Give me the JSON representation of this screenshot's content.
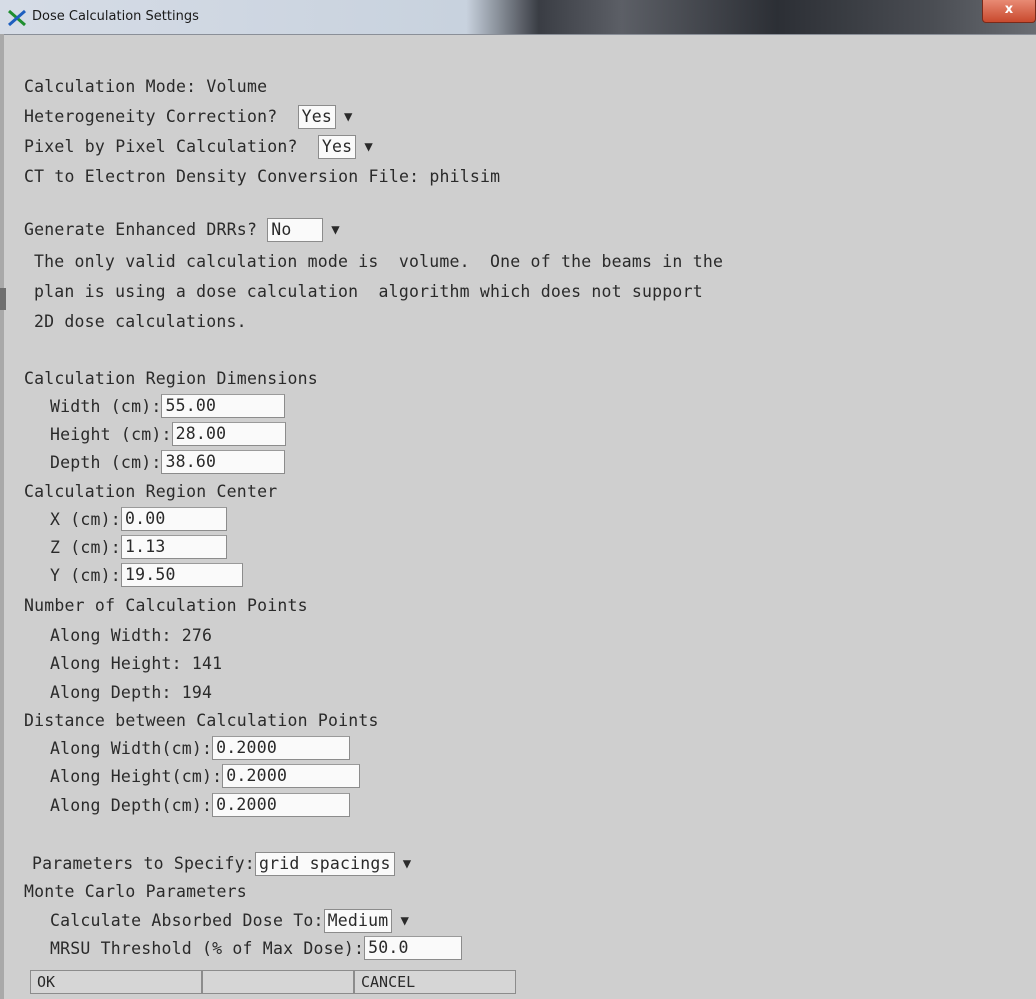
{
  "window": {
    "title": "Dose Calculation Settings",
    "close_label": "x"
  },
  "settings": {
    "calc_mode_line": "Calculation Mode: Volume",
    "hetero_label": "Heterogeneity Correction?",
    "hetero_value": "Yes",
    "pixel_label": "Pixel by Pixel Calculation?",
    "pixel_value": "Yes",
    "ct_line": "CT to Electron Density Conversion File: philsim",
    "drr_label": "Generate Enhanced DRRs?",
    "drr_value": "No",
    "message_lines": [
      "The only valid calculation mode is  volume.  One of the beams in the",
      "plan is using a dose calculation  algorithm which does not support",
      "2D dose calculations."
    ]
  },
  "region_dimensions": {
    "heading": "Calculation Region Dimensions",
    "width_label": "Width (cm):",
    "width_value": "55.00",
    "height_label": "Height (cm):",
    "height_value": "28.00",
    "depth_label": "Depth (cm):",
    "depth_value": "38.60"
  },
  "region_center": {
    "heading": "Calculation Region Center",
    "x_label": "X (cm):",
    "x_value": "0.00",
    "z_label": "Z (cm):",
    "z_value": "1.13",
    "y_label": "Y (cm):",
    "y_value": "19.50"
  },
  "calc_points": {
    "heading": "Number of Calculation Points",
    "width_line": "Along Width: 276",
    "height_line": "Along Height: 141",
    "depth_line": "Along Depth: 194"
  },
  "distance": {
    "heading": "Distance between Calculation Points",
    "width_label": "Along Width(cm):",
    "width_value": "0.2000",
    "height_label": "Along Height(cm):",
    "height_value": "0.2000",
    "depth_label": "Along Depth(cm):",
    "depth_value": "0.2000"
  },
  "params": {
    "specify_label": "Parameters to Specify:",
    "specify_value": "grid spacings"
  },
  "monte_carlo": {
    "heading": "Monte Carlo Parameters",
    "absorbed_label": "Calculate Absorbed Dose To:",
    "absorbed_value": "Medium",
    "mrsu_label": "MRSU Threshold (% of Max Dose):",
    "mrsu_value": "50.0"
  },
  "buttons": {
    "ok": "OK",
    "middle": "",
    "cancel": "CANCEL"
  },
  "colors": {
    "background": "#cfcfcf",
    "field_bg": "#fafafa",
    "close_red": "#c94a2e"
  }
}
